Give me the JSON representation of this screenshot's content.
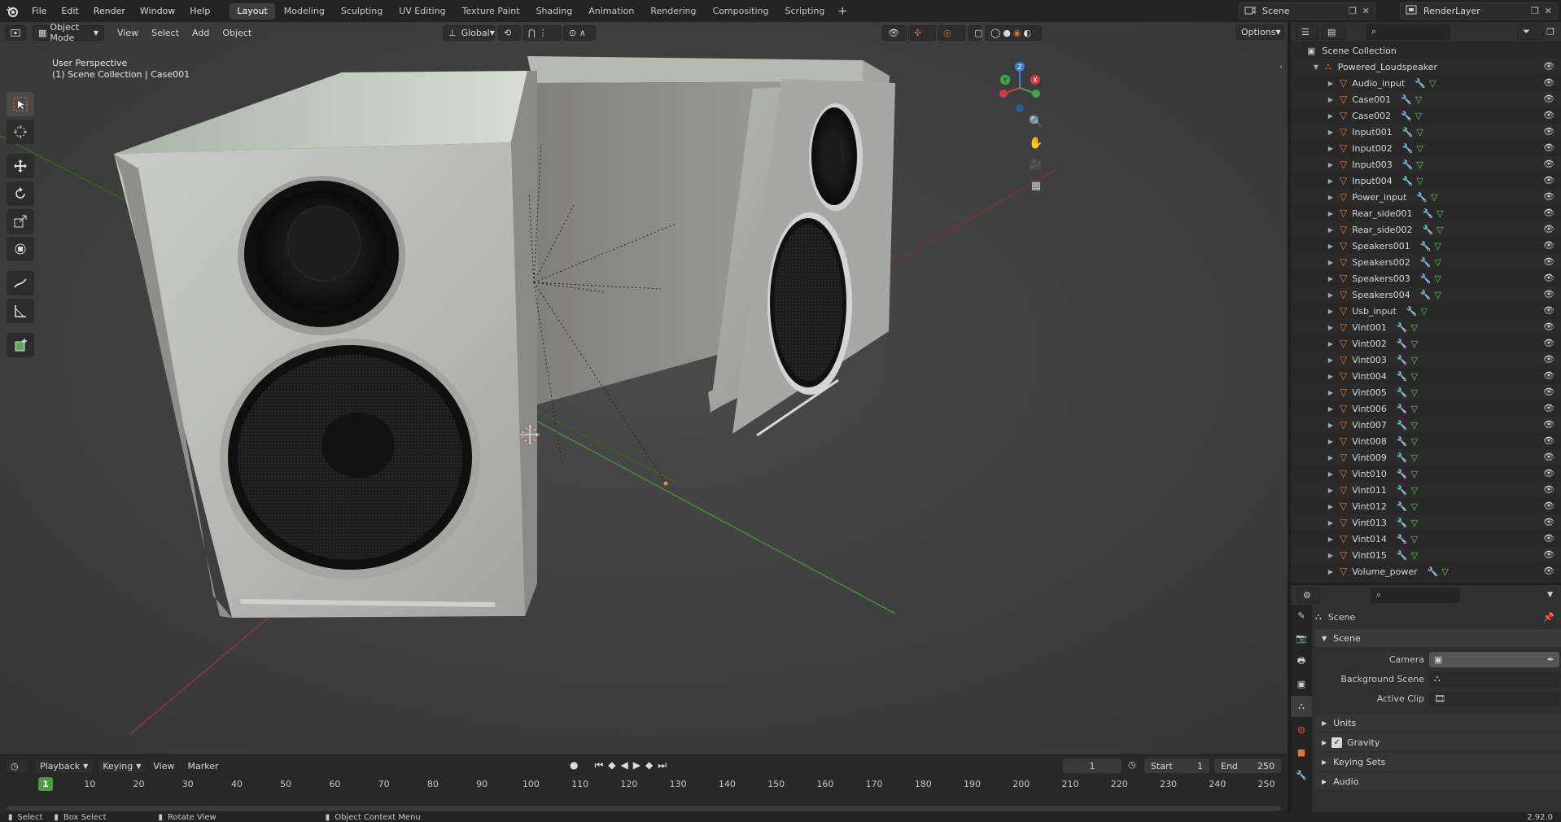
{
  "menubar": {
    "items": [
      "File",
      "Edit",
      "Render",
      "Window",
      "Help"
    ]
  },
  "workspaces": {
    "tabs": [
      "Layout",
      "Modeling",
      "Sculpting",
      "UV Editing",
      "Texture Paint",
      "Shading",
      "Animation",
      "Rendering",
      "Compositing",
      "Scripting"
    ],
    "active": "Layout",
    "add_label": "+"
  },
  "scene_selector": {
    "value": "Scene"
  },
  "view_layer_selector": {
    "value": "RenderLayer"
  },
  "viewport": {
    "mode": "Object Mode",
    "menus": [
      "View",
      "Select",
      "Add",
      "Object"
    ],
    "transform_orientation": "Global",
    "options_label": "Options",
    "overlay_line1": "User Perspective",
    "overlay_line2": "(1) Scene Collection | Case001"
  },
  "gizmo": {
    "axis_z": "Z",
    "axis_y": "Y",
    "axis_x": "X"
  },
  "outliner": {
    "root": "Scene Collection",
    "collection": "Powered_Loudspeaker",
    "items": [
      "Audio_input",
      "Case001",
      "Case002",
      "Input001",
      "Input002",
      "Input003",
      "Input004",
      "Power_input",
      "Rear_side001",
      "Rear_side002",
      "Speakers001",
      "Speakers002",
      "Speakers003",
      "Speakers004",
      "Usb_input",
      "Vint001",
      "Vint002",
      "Vint003",
      "Vint004",
      "Vint005",
      "Vint006",
      "Vint007",
      "Vint008",
      "Vint009",
      "Vint010",
      "Vint011",
      "Vint012",
      "Vint013",
      "Vint014",
      "Vint015",
      "Volume_power"
    ]
  },
  "properties": {
    "context": "Scene",
    "panel_title": "Scene",
    "camera_label": "Camera",
    "background_scene_label": "Background Scene",
    "active_clip_label": "Active Clip",
    "units_label": "Units",
    "gravity_label": "Gravity",
    "gravity_checked": true,
    "keying_sets_label": "Keying Sets",
    "audio_label": "Audio"
  },
  "timeline": {
    "menus": [
      "Playback",
      "Keying",
      "View",
      "Marker"
    ],
    "current_frame": "1",
    "start_label": "Start",
    "start_value": "1",
    "end_label": "End",
    "end_value": "250",
    "ruler": [
      "1",
      "10",
      "20",
      "30",
      "40",
      "50",
      "60",
      "70",
      "80",
      "90",
      "100",
      "110",
      "120",
      "130",
      "140",
      "150",
      "160",
      "170",
      "180",
      "190",
      "200",
      "210",
      "220",
      "230",
      "240",
      "250"
    ]
  },
  "statusbar": {
    "select": "Select",
    "box_select": "Box Select",
    "rotate_view": "Rotate View",
    "context_menu": "Object Context Menu",
    "version": "2.92.0"
  },
  "colors": {
    "accent_orange": "#e8772e",
    "active_tab_bg": "#3d3d3d",
    "frame_marker": "#4a9d3a"
  }
}
